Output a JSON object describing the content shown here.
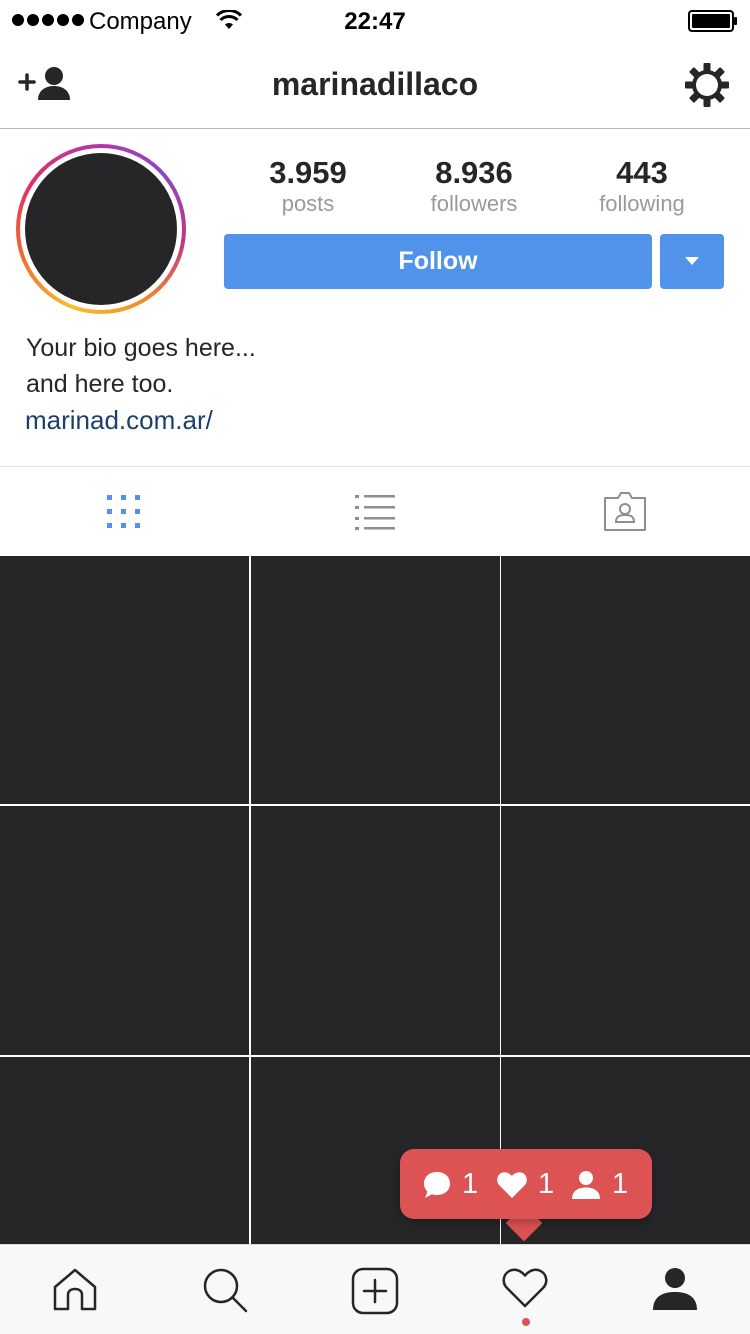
{
  "status_bar": {
    "carrier": "Company",
    "time": "22:47",
    "signal_bars": 5
  },
  "nav": {
    "title": "marinadillaco",
    "left_icon": "add-user-icon",
    "right_icon": "settings-gear-icon"
  },
  "profile": {
    "stats": [
      {
        "value": "3.959",
        "label": "posts"
      },
      {
        "value": "8.936",
        "label": "followers"
      },
      {
        "value": "443",
        "label": "following"
      }
    ],
    "follow_label": "Follow",
    "bio_line1": "Your bio goes here...",
    "bio_line2": "and here too.",
    "link": "marinad.com.ar/"
  },
  "view_tabs": [
    {
      "icon": "grid-view-icon",
      "active": true
    },
    {
      "icon": "list-view-icon",
      "active": false
    },
    {
      "icon": "tagged-photos-icon",
      "active": false
    }
  ],
  "grid": {
    "cells": 9,
    "cell_color": "#262628"
  },
  "notification": {
    "comments": "1",
    "likes": "1",
    "follows": "1",
    "color": "#dd5252"
  },
  "tab_bar": [
    {
      "icon": "home-icon"
    },
    {
      "icon": "search-icon"
    },
    {
      "icon": "add-post-icon"
    },
    {
      "icon": "activity-heart-icon"
    },
    {
      "icon": "profile-icon"
    }
  ],
  "colors": {
    "accent": "#5193ea",
    "link": "#1b3f6f",
    "muted": "#9a9a9a",
    "dark": "#262626"
  }
}
